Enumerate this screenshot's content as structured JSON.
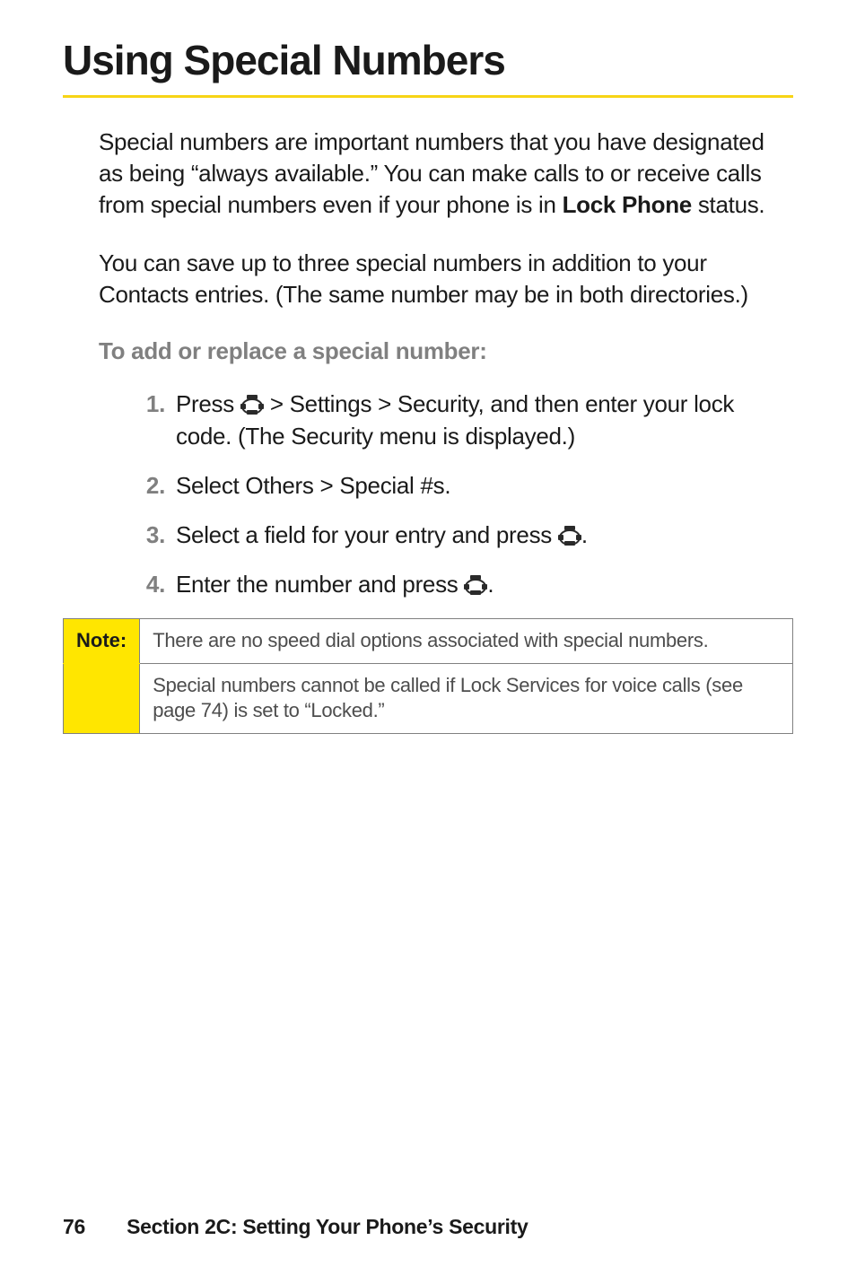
{
  "title": "Using Special Numbers",
  "paragraphs": {
    "p1_head": "Special numbers are important numbers that you have designated as being “always available.” You can make calls to or receive calls from special numbers even if your phone is in ",
    "p1_bold": "Lock Phone",
    "p1_tail": " status.",
    "p2": "You can save up to three special numbers in addition to your Contacts entries. (The same number may be in both directories.)"
  },
  "subhead": "To add or replace a special number:",
  "steps": [
    {
      "num": "1.",
      "parts": [
        {
          "t": "text",
          "v": "Press "
        },
        {
          "t": "icon"
        },
        {
          "t": "bold",
          "v": " > Settings > Security"
        },
        {
          "t": "text",
          "v": ", and then enter your lock code. (The Security menu is displayed.)"
        }
      ]
    },
    {
      "num": "2.",
      "parts": [
        {
          "t": "text",
          "v": "Select "
        },
        {
          "t": "bold",
          "v": "Others > Special #s"
        },
        {
          "t": "text",
          "v": "."
        }
      ]
    },
    {
      "num": "3.",
      "parts": [
        {
          "t": "text",
          "v": "Select a field for your entry and press "
        },
        {
          "t": "icon"
        },
        {
          "t": "text",
          "v": "."
        }
      ]
    },
    {
      "num": "4.",
      "parts": [
        {
          "t": "text",
          "v": "Enter the number and press "
        },
        {
          "t": "icon"
        },
        {
          "t": "text",
          "v": "."
        }
      ]
    }
  ],
  "note": {
    "label": "Note:",
    "rows": [
      "There are no speed dial options associated with special numbers.",
      "Special numbers cannot be called if Lock Services for voice calls (see page 74) is set to “Locked.”"
    ]
  },
  "footer": {
    "page": "76",
    "section": "Section 2C: Setting Your Phone’s Security"
  }
}
